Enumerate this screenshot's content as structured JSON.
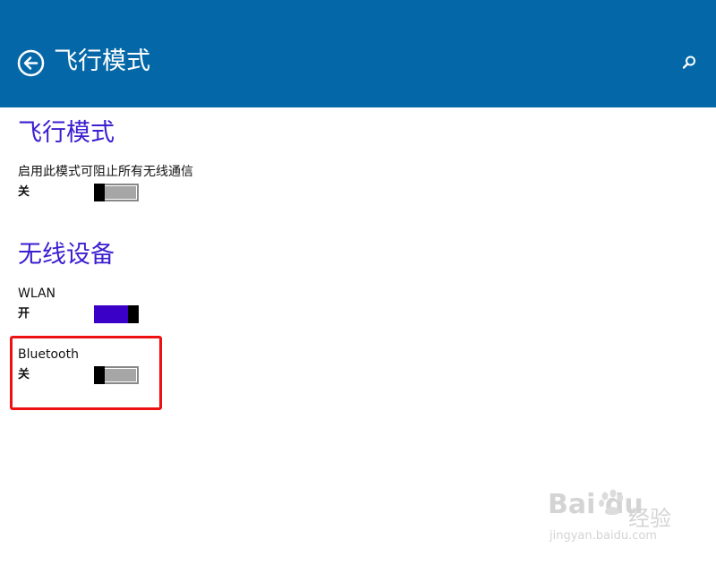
{
  "header": {
    "title": "飞行模式",
    "back_icon": "back-arrow-circle-icon",
    "search_icon": "search-icon",
    "background": "#0468a8"
  },
  "airplane": {
    "section_title": "飞行模式",
    "setting_label": "启用此模式可阻止所有无线通信",
    "state_label": "关",
    "is_on": false
  },
  "wireless": {
    "section_title": "无线设备",
    "devices": [
      {
        "label": "WLAN",
        "state_label": "开",
        "is_on": true
      },
      {
        "label": "Bluetooth",
        "state_label": "关",
        "is_on": false
      }
    ]
  },
  "colors": {
    "accent": "#3c1ed0",
    "toggle_on": "#3a00c8",
    "toggle_off": "#a6a6a6",
    "highlight": "#ee1111"
  },
  "watermark": {
    "logo": "Bai du",
    "cn": "经验",
    "url": "jingyan.baidu.com"
  }
}
